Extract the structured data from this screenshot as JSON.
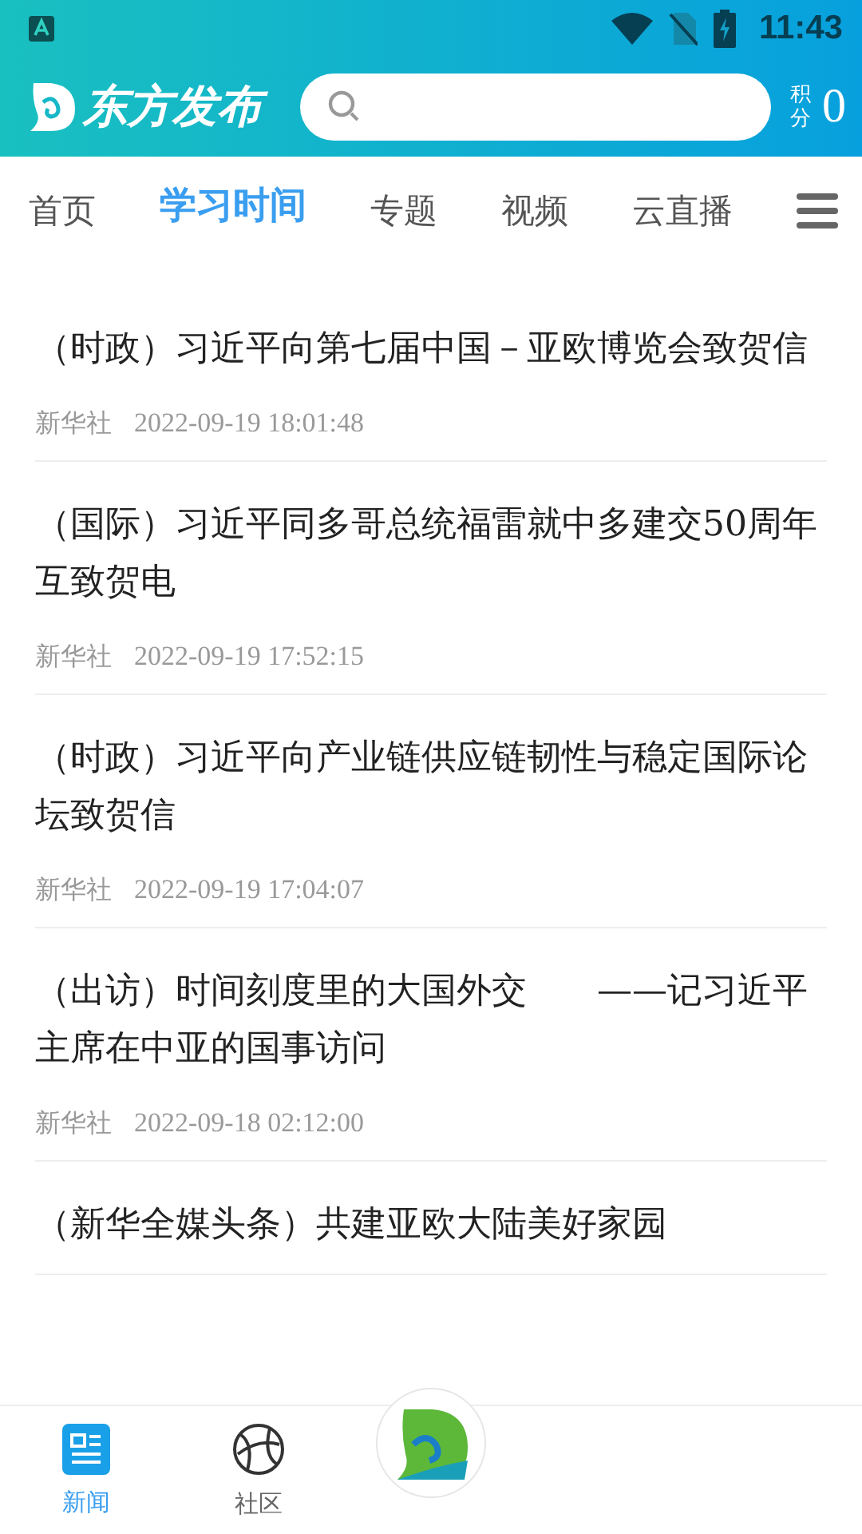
{
  "status_bar": {
    "time": "11:43"
  },
  "header": {
    "logo_text": "东方发布",
    "points_label": "积分",
    "points_value": "0"
  },
  "tabs": [
    {
      "label": "首页",
      "selected": false
    },
    {
      "label": "学习时间",
      "selected": true
    },
    {
      "label": "专题",
      "selected": false
    },
    {
      "label": "视频",
      "selected": false
    },
    {
      "label": "云直播",
      "selected": false
    }
  ],
  "news": [
    {
      "title": "（时政）习近平向第七届中国－亚欧博览会致贺信",
      "source": "新华社",
      "time": "2022-09-19 18:01:48"
    },
    {
      "title": "（国际）习近平同多哥总统福雷就中多建交50周年互致贺电",
      "source": "新华社",
      "time": "2022-09-19 17:52:15"
    },
    {
      "title": "（时政）习近平向产业链供应链韧性与稳定国际论坛致贺信",
      "source": "新华社",
      "time": "2022-09-19 17:04:07"
    },
    {
      "title": "（出访）时间刻度里的大国外交　　——记习近平主席在中亚的国事访问",
      "source": "新华社",
      "time": "2022-09-18 02:12:00"
    },
    {
      "title": "（新华全媒头条）共建亚欧大陆美好家园"
    }
  ],
  "bottom_nav": [
    {
      "kind": "news",
      "label": "新闻",
      "selected": true
    },
    {
      "kind": "community",
      "label": "社区",
      "selected": false
    },
    {
      "kind": "center"
    }
  ]
}
